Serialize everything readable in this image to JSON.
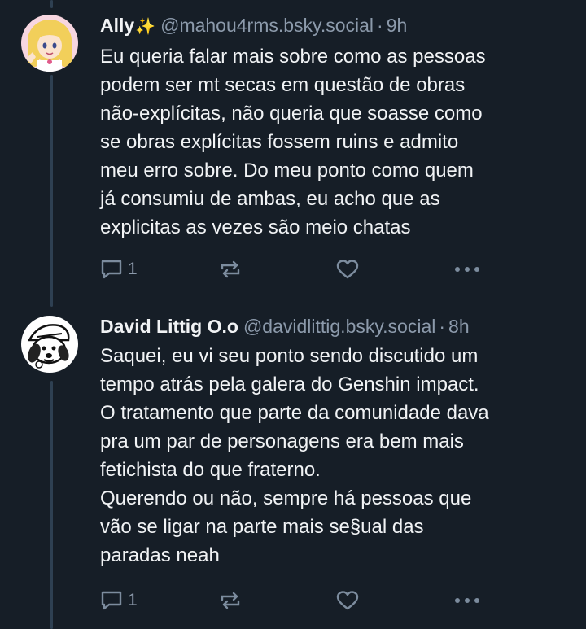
{
  "posts": [
    {
      "display_name": "Ally",
      "display_name_emoji": "✨",
      "handle": "@mahou4rms.bsky.social",
      "separator": "·",
      "time": "9h",
      "text": "Eu queria falar mais sobre como as pessoas\npodem ser mt secas em questão de obras\nnão-explícitas, não queria que soasse como\nse obras explícitas fossem ruins e admito\nmeu erro sobre. Do meu ponto como quem\njá consumiu de ambas, eu acho que as\nexplicitas as vezes são meio chatas",
      "reply_count": "1",
      "icons": {
        "reply": "speech-bubble-icon",
        "repost": "repost-arrows-icon",
        "like": "heart-icon",
        "more": "more-dots-icon"
      }
    },
    {
      "display_name": "David Littig O.o",
      "display_name_emoji": "",
      "handle": "@davidlittig.bsky.social",
      "separator": "·",
      "time": "8h",
      "text": "Saquei, eu vi seu ponto sendo discutido um\ntempo atrás pela galera do Genshin impact.\nO tratamento que parte da comunidade dava\npra um par de personagens era bem mais\nfetichista do que fraterno.\nQuerendo ou não, sempre há pessoas que\nvão se ligar na parte mais se§ual das\nparadas neah",
      "reply_count": "1",
      "icons": {
        "reply": "speech-bubble-icon",
        "repost": "repost-arrows-icon",
        "like": "heart-icon",
        "more": "more-dots-icon"
      }
    }
  ],
  "colors": {
    "background": "#161e27",
    "text": "#f1f3f5",
    "muted": "#8c9aab",
    "icon": "#7c8c9e",
    "thread_line": "#2e4052",
    "sparkle": "#f5c518"
  }
}
